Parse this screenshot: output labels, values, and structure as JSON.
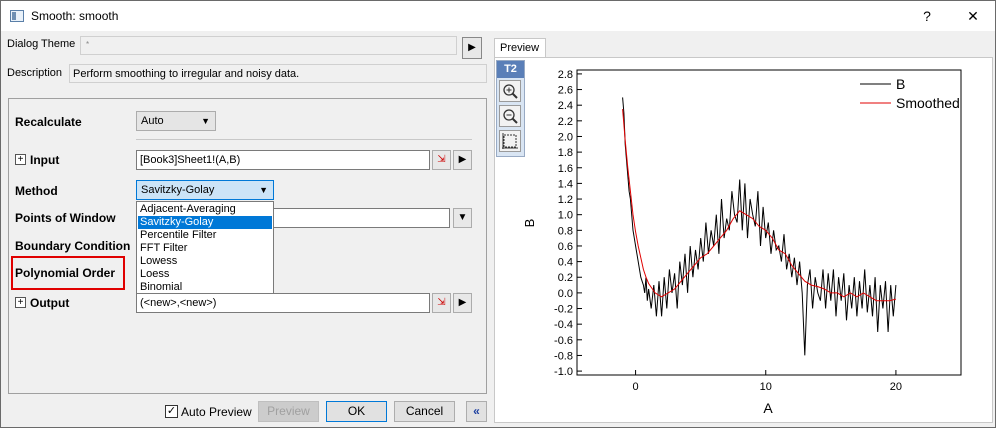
{
  "window": {
    "title": "Smooth: smooth",
    "help_label": "?",
    "close_label": "✕"
  },
  "top": {
    "dialog_theme_label": "Dialog Theme",
    "dialog_theme_value": "*",
    "description_label": "Description",
    "description_value": "Perform smoothing to irregular and noisy data."
  },
  "form": {
    "recalculate_label": "Recalculate",
    "recalculate_value": "Auto",
    "input_label": "Input",
    "input_value": "[Book3]Sheet1!(A,B)",
    "method_label": "Method",
    "method_value": "Savitzky-Golay",
    "points_label": "Points of Window",
    "boundary_label": "Boundary Condition",
    "poly_label": "Polynomial Order",
    "output_label": "Output",
    "output_value": "(<new>,<new>)",
    "method_options": [
      "Adjacent-Averaging",
      "Savitzky-Golay",
      "Percentile Filter",
      "FFT Filter",
      "Lowess",
      "Loess",
      "Binomial"
    ],
    "method_selected_index": 1
  },
  "footer": {
    "auto_preview_label": "Auto Preview",
    "auto_preview_checked": true,
    "preview_label": "Preview",
    "ok_label": "OK",
    "cancel_label": "Cancel",
    "collapse_label": "«"
  },
  "preview": {
    "tab_label": "Preview",
    "toolbar": {
      "t2_label": "T2",
      "icons": [
        "zoom-in-icon",
        "zoom-out-icon",
        "rescale-icon"
      ]
    }
  },
  "chart_data": {
    "type": "line",
    "xlabel": "A",
    "ylabel": "B",
    "xlim": [
      -4.5,
      25
    ],
    "ylim": [
      -1.05,
      2.85
    ],
    "xticks": [
      0,
      10,
      20
    ],
    "yticks": [
      -1.0,
      -0.8,
      -0.6,
      -0.4,
      -0.2,
      0.0,
      0.2,
      0.4,
      0.6,
      0.8,
      1.0,
      1.2,
      1.4,
      1.6,
      1.8,
      2.0,
      2.2,
      2.4,
      2.6,
      2.8
    ],
    "legend_position": "top-right",
    "colors": {
      "B": "#000000",
      "Smoothed": "#e00000"
    },
    "series": [
      {
        "name": "B",
        "x": [
          -1.0,
          -0.9,
          -0.8,
          -0.7,
          -0.6,
          -0.5,
          -0.4,
          -0.3,
          -0.2,
          -0.1,
          0.0,
          0.1,
          0.2,
          0.3,
          0.4,
          0.5,
          0.6,
          0.7,
          0.8,
          0.9,
          1.0,
          1.2,
          1.4,
          1.6,
          1.8,
          2.0,
          2.2,
          2.4,
          2.6,
          2.8,
          3.0,
          3.2,
          3.4,
          3.6,
          3.8,
          4.0,
          4.2,
          4.4,
          4.6,
          4.8,
          5.0,
          5.2,
          5.4,
          5.6,
          5.8,
          6.0,
          6.2,
          6.4,
          6.6,
          6.8,
          7.0,
          7.2,
          7.4,
          7.6,
          7.8,
          8.0,
          8.2,
          8.4,
          8.6,
          8.8,
          9.0,
          9.2,
          9.4,
          9.6,
          9.8,
          10.0,
          10.2,
          10.4,
          10.6,
          10.8,
          11.0,
          11.2,
          11.4,
          11.6,
          11.8,
          12.0,
          12.2,
          12.4,
          12.6,
          12.8,
          13.0,
          13.2,
          13.4,
          13.6,
          13.8,
          14.0,
          14.2,
          14.4,
          14.6,
          14.8,
          15.0,
          15.2,
          15.4,
          15.6,
          15.8,
          16.0,
          16.2,
          16.4,
          16.6,
          16.8,
          17.0,
          17.2,
          17.4,
          17.6,
          17.8,
          18.0,
          18.2,
          18.4,
          18.6,
          18.8,
          19.0,
          19.2,
          19.4,
          19.6,
          19.8,
          20.0
        ],
        "y": [
          2.5,
          2.3,
          1.9,
          1.7,
          1.5,
          1.3,
          1.2,
          1.0,
          0.8,
          0.7,
          0.6,
          0.5,
          0.4,
          0.3,
          0.2,
          0.15,
          0.1,
          0.0,
          0.2,
          -0.1,
          0.05,
          -0.2,
          0.1,
          -0.3,
          0.15,
          -0.3,
          0.2,
          -0.2,
          0.3,
          0.0,
          0.25,
          -0.2,
          0.4,
          0.1,
          0.5,
          0.0,
          0.6,
          0.2,
          0.55,
          0.3,
          0.7,
          0.4,
          0.9,
          0.5,
          0.8,
          0.6,
          1.0,
          0.5,
          1.2,
          0.7,
          0.95,
          0.8,
          1.3,
          1.0,
          0.9,
          1.45,
          0.8,
          1.4,
          0.7,
          1.2,
          1.0,
          0.85,
          1.3,
          0.6,
          1.1,
          0.7,
          0.9,
          0.5,
          0.8,
          0.55,
          0.6,
          0.4,
          0.75,
          0.3,
          0.5,
          0.2,
          0.45,
          0.1,
          0.4,
          0.0,
          -0.8,
          0.1,
          0.3,
          -0.2,
          0.2,
          0.0,
          -0.1,
          0.3,
          -0.2,
          0.25,
          -0.1,
          0.3,
          -0.3,
          0.2,
          -0.1,
          0.25,
          -0.35,
          0.1,
          -0.2,
          0.2,
          -0.3,
          0.15,
          -0.2,
          0.3,
          -0.25,
          0.1,
          -0.3,
          0.2,
          -0.5,
          0.1,
          -0.2,
          0.15,
          -0.5,
          0.1,
          -0.3,
          0.1
        ]
      },
      {
        "name": "Smoothed",
        "x": [
          -1.0,
          -0.8,
          -0.6,
          -0.4,
          -0.2,
          0.0,
          0.2,
          0.4,
          0.6,
          0.8,
          1.0,
          1.5,
          2.0,
          2.5,
          3.0,
          3.5,
          4.0,
          4.5,
          5.0,
          5.5,
          6.0,
          6.5,
          7.0,
          7.5,
          8.0,
          8.5,
          9.0,
          9.5,
          10.0,
          10.5,
          11.0,
          11.5,
          12.0,
          12.5,
          13.0,
          13.5,
          14.0,
          14.5,
          15.0,
          15.5,
          16.0,
          16.5,
          17.0,
          17.5,
          18.0,
          18.5,
          19.0,
          19.5,
          20.0
        ],
        "y": [
          2.35,
          1.95,
          1.6,
          1.3,
          1.0,
          0.78,
          0.6,
          0.45,
          0.3,
          0.2,
          0.12,
          0.0,
          -0.05,
          0.0,
          0.05,
          0.15,
          0.25,
          0.35,
          0.45,
          0.5,
          0.6,
          0.7,
          0.8,
          0.95,
          1.05,
          1.0,
          0.95,
          0.85,
          0.8,
          0.7,
          0.55,
          0.5,
          0.35,
          0.25,
          0.15,
          0.1,
          0.08,
          0.05,
          0.0,
          0.0,
          -0.05,
          0.0,
          -0.05,
          0.0,
          -0.05,
          -0.1,
          -0.1,
          -0.1,
          -0.08
        ]
      }
    ]
  }
}
